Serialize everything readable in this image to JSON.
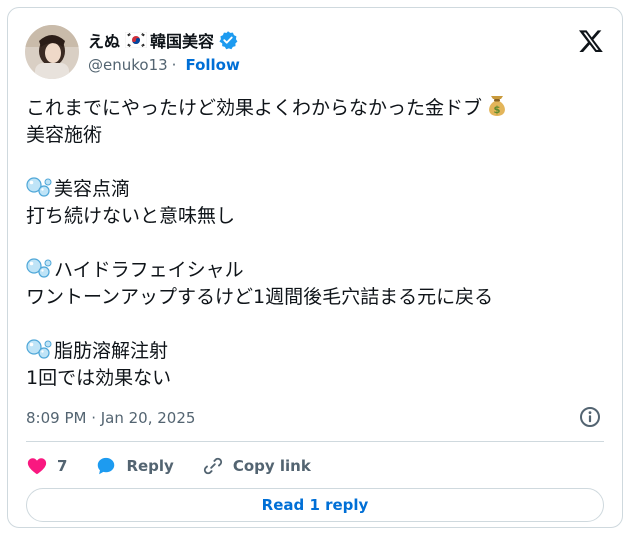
{
  "user": {
    "display_name": "えぬ",
    "display_suffix": "韓国美容",
    "handle": "@enuko13",
    "separator": "·",
    "follow_label": "Follow"
  },
  "tweet": {
    "lines": [
      "これまでにやったけど効果よくわからなかった金ドブ",
      "美容施術",
      "美容点滴",
      "打ち続けないと意味無し",
      "ハイドラフェイシャル",
      "ワントーンアップするけど1週間後毛穴詰まる元に戻る",
      "脂肪溶解注射",
      "1回では効果ない"
    ],
    "timestamp": "8:09 PM · Jan 20, 2025"
  },
  "actions": {
    "like_count": "7",
    "reply_label": "Reply",
    "copy_link_label": "Copy link"
  },
  "read_replies_label": "Read 1 reply",
  "colors": {
    "link": "#006fd6",
    "muted": "#536471",
    "like": "#f91880",
    "border": "#cfd9de",
    "verified": "#1d9bf0"
  },
  "icons": [
    "avatar-photo",
    "korea-flag-icon",
    "verified-badge-icon",
    "x-logo-icon",
    "money-bag-icon",
    "bubbles-icon",
    "info-icon",
    "heart-icon",
    "reply-bubble-icon",
    "link-icon"
  ]
}
